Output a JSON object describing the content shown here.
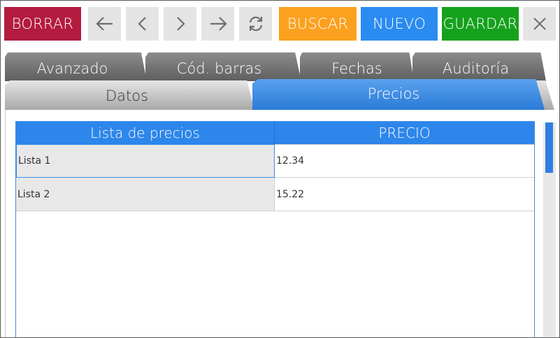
{
  "toolbar": {
    "borrar": "BORRAR",
    "buscar": "BUSCAR",
    "nuevo": "NUEVO",
    "guardar": "GUARDAR",
    "icons": [
      "arrow-left-icon",
      "chevron-left-icon",
      "chevron-right-icon",
      "arrow-right-icon",
      "refresh-icon",
      "close-icon"
    ]
  },
  "colors": {
    "borrar": "#b31b3f",
    "buscar": "#fba11f",
    "nuevo": "#2a8cf0",
    "guardar": "#16a11d",
    "accent": "#2d86ea"
  },
  "tabs": {
    "row1": [
      "Avanzado",
      "Cód. barras",
      "Fechas",
      "Auditoría"
    ],
    "row2": [
      "Datos",
      "Precios"
    ],
    "active": "Precios"
  },
  "grid": {
    "columns": [
      "Lista de precios",
      "PRECIO"
    ],
    "rows": [
      {
        "lista": "Lista 1",
        "precio": "12.34"
      },
      {
        "lista": "Lista 2",
        "precio": "15.22"
      }
    ]
  }
}
